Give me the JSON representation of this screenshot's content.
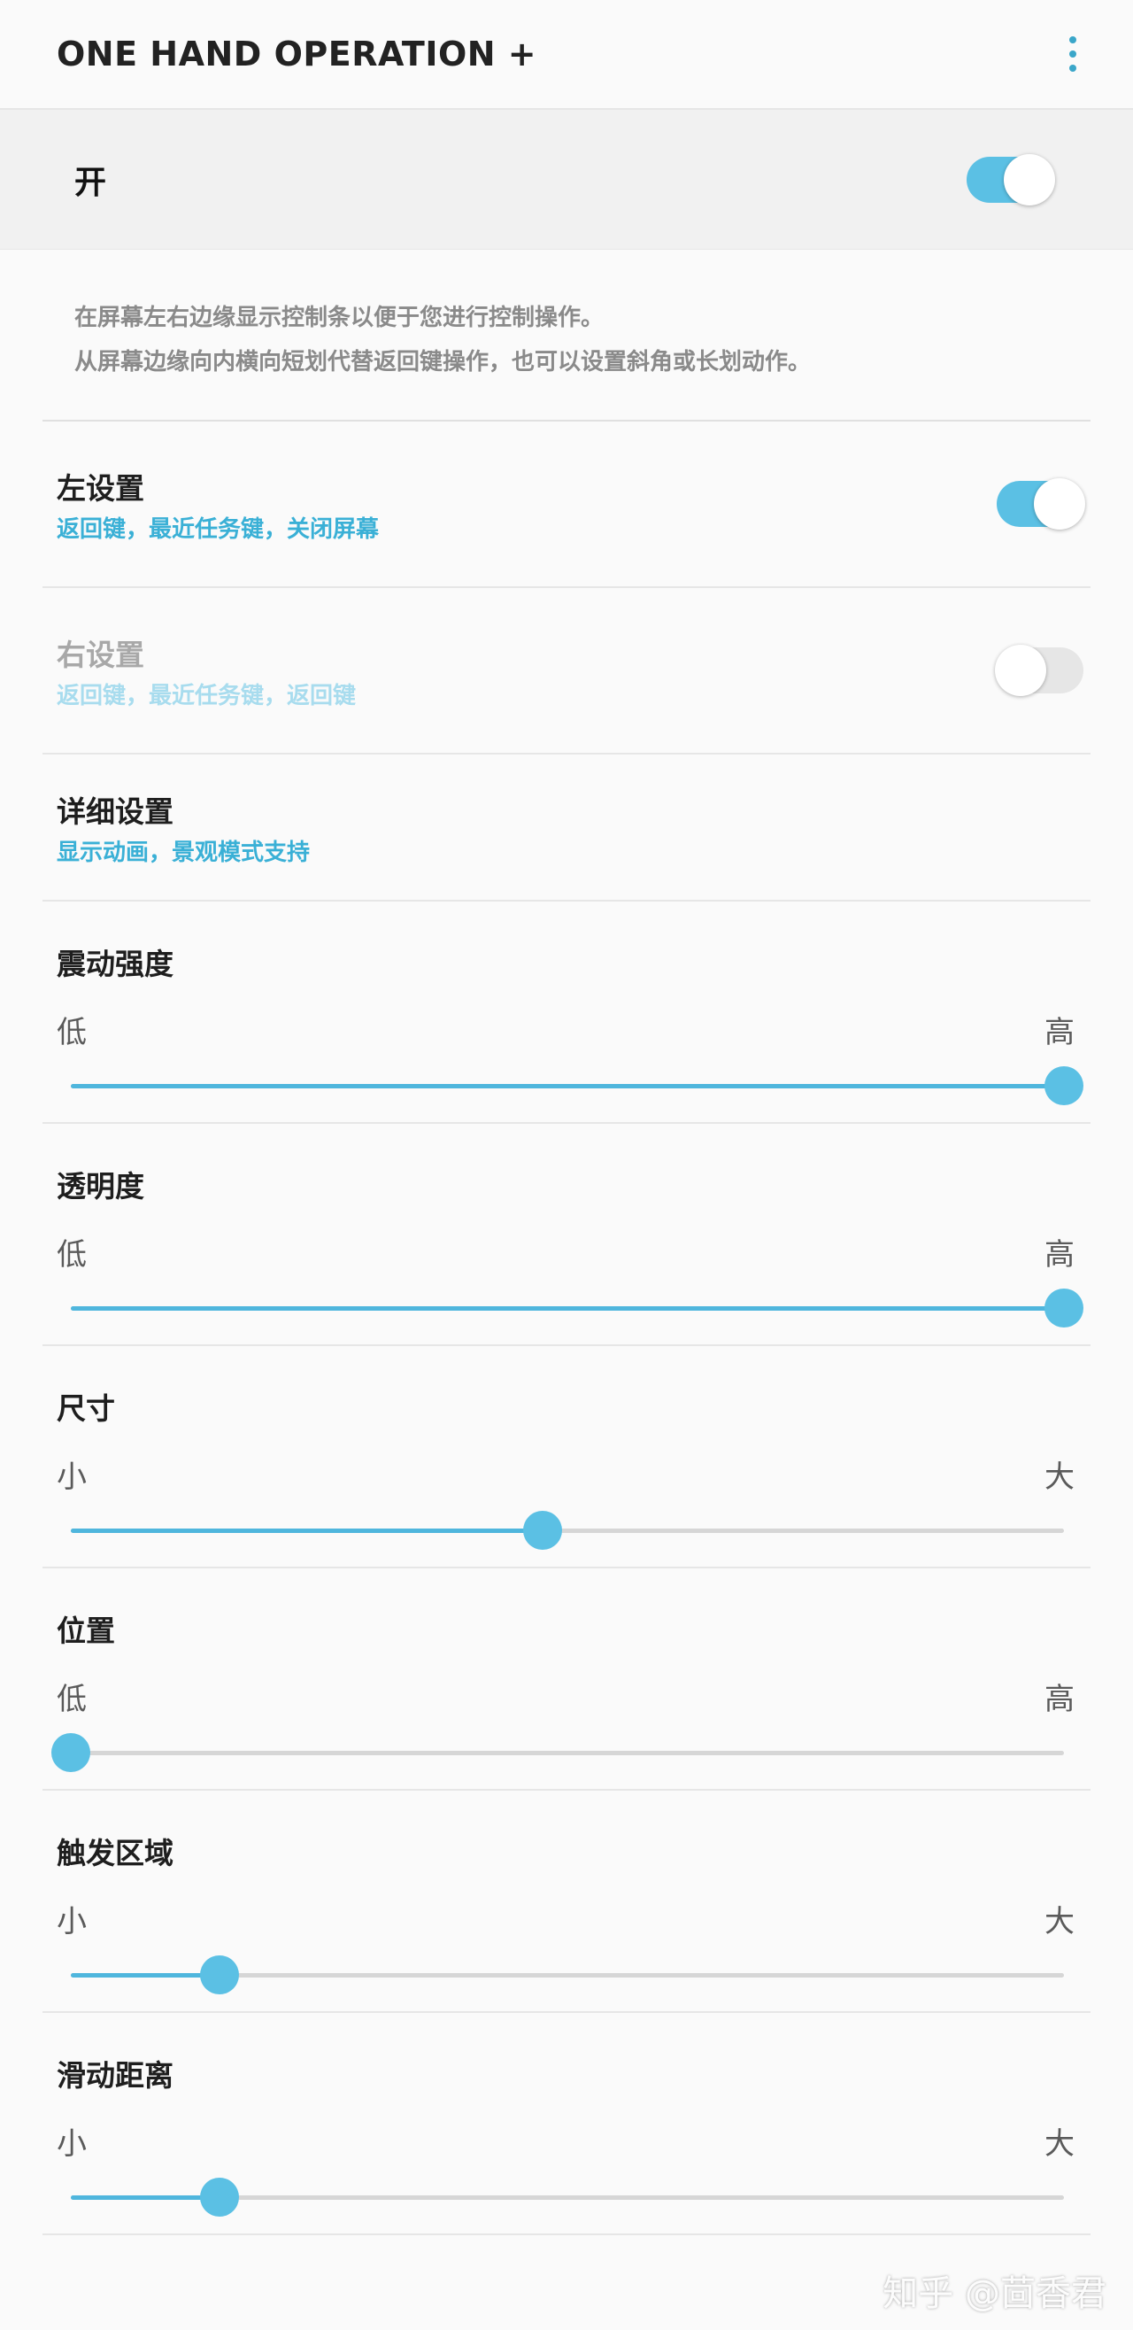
{
  "header": {
    "title": "ONE HAND OPERATION +",
    "menu_icon": "more-vert-icon"
  },
  "master": {
    "label": "开",
    "enabled": true
  },
  "description": {
    "line1": "在屏幕左右边缘显示控制条以便于您进行控制操作。",
    "line2": "从屏幕边缘向内横向短划代替返回键操作，也可以设置斜角或长划动作。"
  },
  "left_settings": {
    "title": "左设置",
    "summary": "返回键，最近任务键，关闭屏幕",
    "enabled": true
  },
  "right_settings": {
    "title": "右设置",
    "summary": "返回键，最近任务键，返回键",
    "enabled": false
  },
  "detail_settings": {
    "title": "详细设置",
    "summary": "显示动画，景观模式支持"
  },
  "sliders": [
    {
      "title": "震动强度",
      "min_label": "低",
      "max_label": "高",
      "value": 1.0
    },
    {
      "title": "透明度",
      "min_label": "低",
      "max_label": "高",
      "value": 1.0
    },
    {
      "title": "尺寸",
      "min_label": "小",
      "max_label": "大",
      "value": 0.475
    },
    {
      "title": "位置",
      "min_label": "低",
      "max_label": "高",
      "value": 0.0
    },
    {
      "title": "触发区域",
      "min_label": "小",
      "max_label": "大",
      "value": 0.15
    },
    {
      "title": "滑动距离",
      "min_label": "小",
      "max_label": "大",
      "value": 0.15
    }
  ],
  "watermark": "知乎 @茴香君",
  "colors": {
    "accent": "#5bc0e4",
    "summary_text": "#3ab0d6"
  }
}
